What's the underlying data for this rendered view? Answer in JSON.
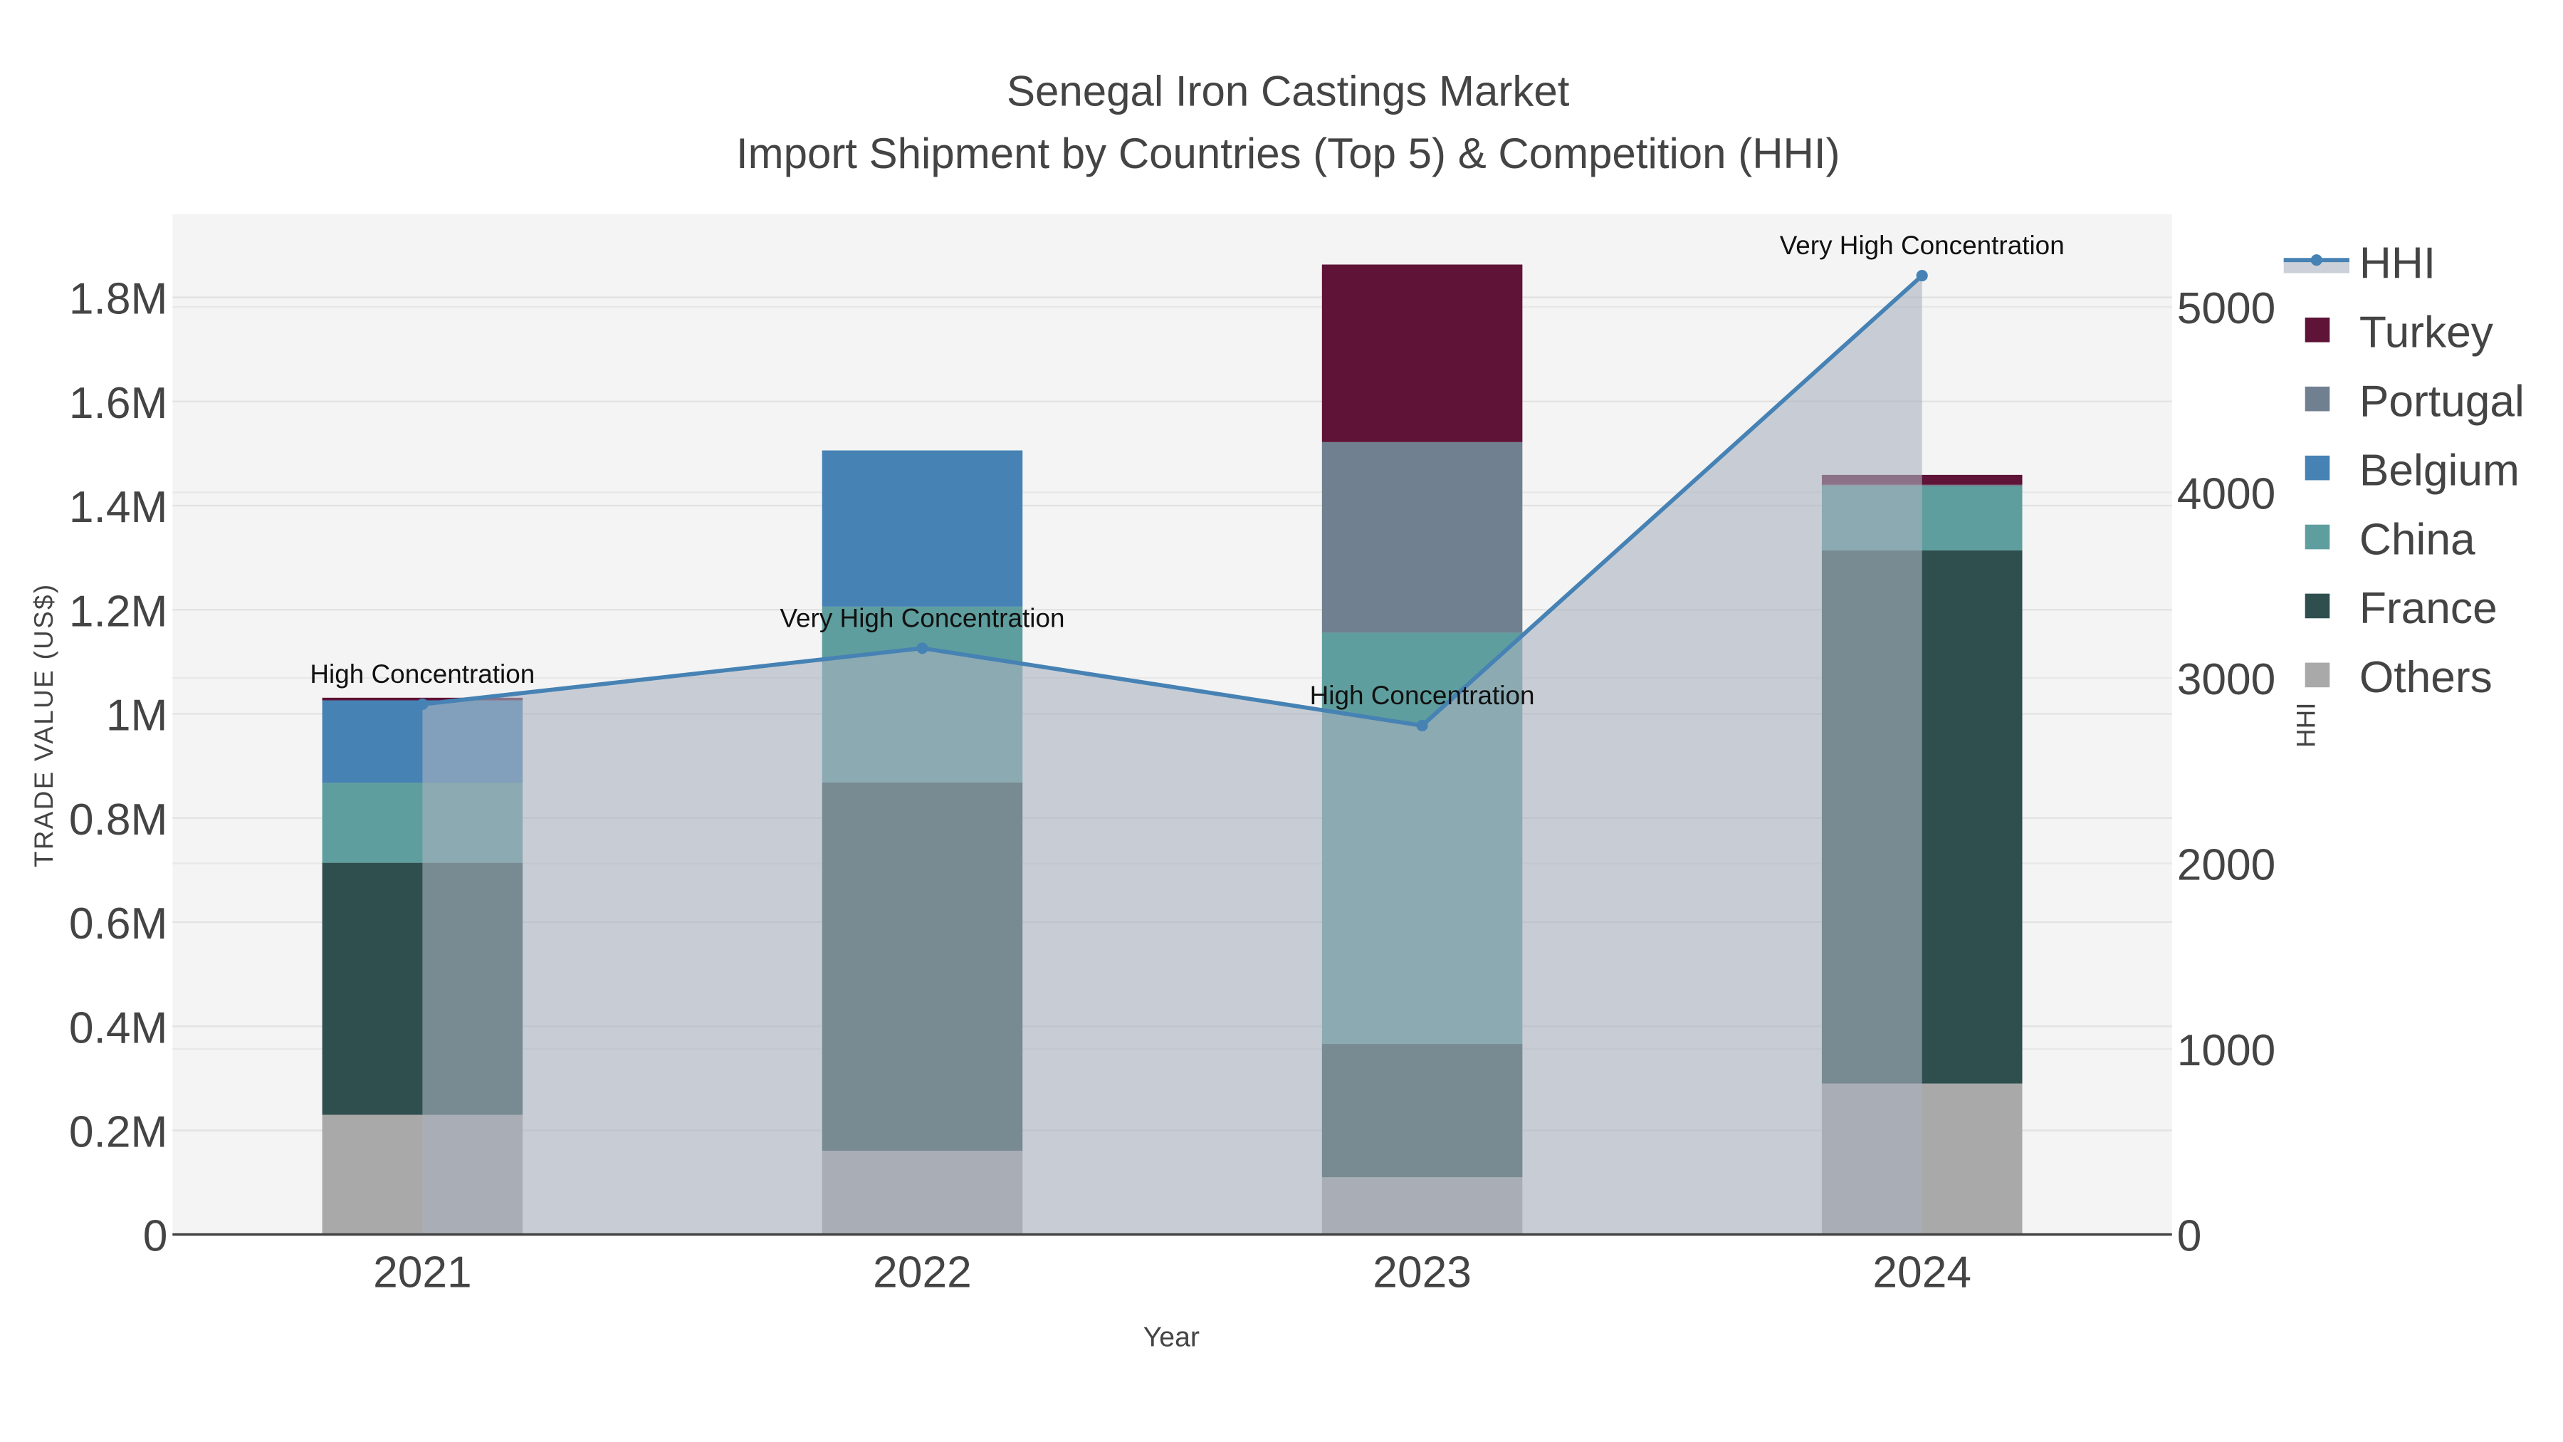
{
  "chart_data": {
    "type": "bar",
    "title": "Senegal Iron Castings Market",
    "subtitle": "Import Shipment by Countries (Top 5) & Competition (HHI)",
    "xlabel": "Year",
    "ylabel": "TRADE VALUE (US$)",
    "y2label": "HHI",
    "categories": [
      "2021",
      "2022",
      "2023",
      "2024"
    ],
    "ylim": [
      0,
      1960000
    ],
    "y2lim": [
      0,
      5500
    ],
    "yticks": [
      0,
      200000,
      400000,
      600000,
      800000,
      1000000,
      1200000,
      1400000,
      1600000,
      1800000
    ],
    "ytick_labels": [
      "0",
      "0.2M",
      "0.4M",
      "0.6M",
      "0.8M",
      "1M",
      "1.2M",
      "1.4M",
      "1.6M",
      "1.8M"
    ],
    "y2ticks": [
      0,
      1000,
      2000,
      3000,
      4000,
      5000
    ],
    "y2tick_labels": [
      "0",
      "1000",
      "2000",
      "3000",
      "4000",
      "5000"
    ],
    "stacked": true,
    "grid": true,
    "legend_position": "right",
    "series": [
      {
        "name": "Others",
        "color": "#a9a9a9",
        "values": [
          230000,
          161000,
          110000,
          290000
        ]
      },
      {
        "name": "France",
        "color": "#2f4f4f",
        "values": [
          484000,
          707000,
          256000,
          1024000
        ]
      },
      {
        "name": "China",
        "color": "#5f9e9e",
        "values": [
          154000,
          338000,
          790000,
          123000
        ]
      },
      {
        "name": "Belgium",
        "color": "#4682b4",
        "values": [
          158000,
          300000,
          0,
          0
        ]
      },
      {
        "name": "Portugal",
        "color": "#708090",
        "values": [
          0,
          0,
          366000,
          3000
        ]
      },
      {
        "name": "Turkey",
        "color": "#5f1336",
        "values": [
          5000,
          0,
          341000,
          19000
        ]
      }
    ],
    "hhi": {
      "name": "HHI",
      "color": "#4682b4",
      "values": [
        2858,
        3160,
        2743,
        5168
      ],
      "annotations": [
        "High Concentration",
        "Very High Concentration",
        "High Concentration",
        "Very High Concentration"
      ]
    },
    "legend_order": [
      "HHI",
      "Turkey",
      "Portugal",
      "Belgium",
      "China",
      "France",
      "Others"
    ]
  }
}
